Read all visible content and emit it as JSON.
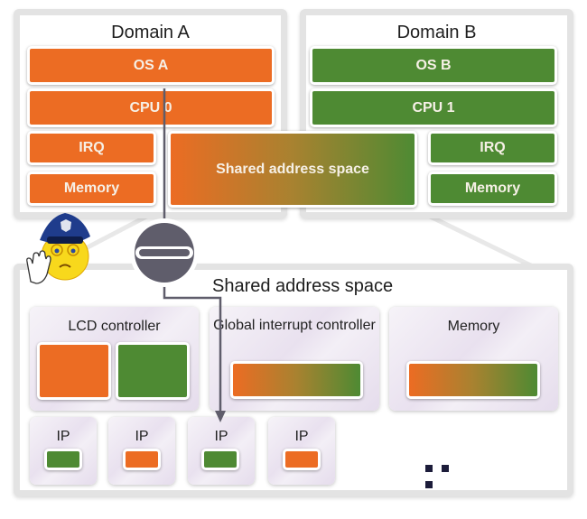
{
  "colors": {
    "domain_a": "#ec6c23",
    "domain_b": "#4e8a33",
    "connector": "#5f5d6b",
    "panel_border": "#e3e3e3"
  },
  "domain_a": {
    "title": "Domain A",
    "os": "OS A",
    "cpu": "CPU 0",
    "irq": "IRQ",
    "memory": "Memory"
  },
  "domain_b": {
    "title": "Domain B",
    "os": "OS B",
    "cpu": "CPU 1",
    "irq": "IRQ",
    "memory": "Memory"
  },
  "shared_block": {
    "label": "Shared address space"
  },
  "shared_panel": {
    "title": "Shared address space",
    "lcd_controller": "LCD controller",
    "gic": "Global interrupt controller",
    "memory": "Memory",
    "ip_blocks": [
      {
        "label": "IP",
        "owner": "B"
      },
      {
        "label": "IP",
        "owner": "A"
      },
      {
        "label": "IP",
        "owner": "B"
      },
      {
        "label": "IP",
        "owner": "A"
      }
    ],
    "ellipsis": "..."
  },
  "icons": {
    "guard": "police-officer-stop-icon",
    "blocked": "no-entry-icon"
  }
}
